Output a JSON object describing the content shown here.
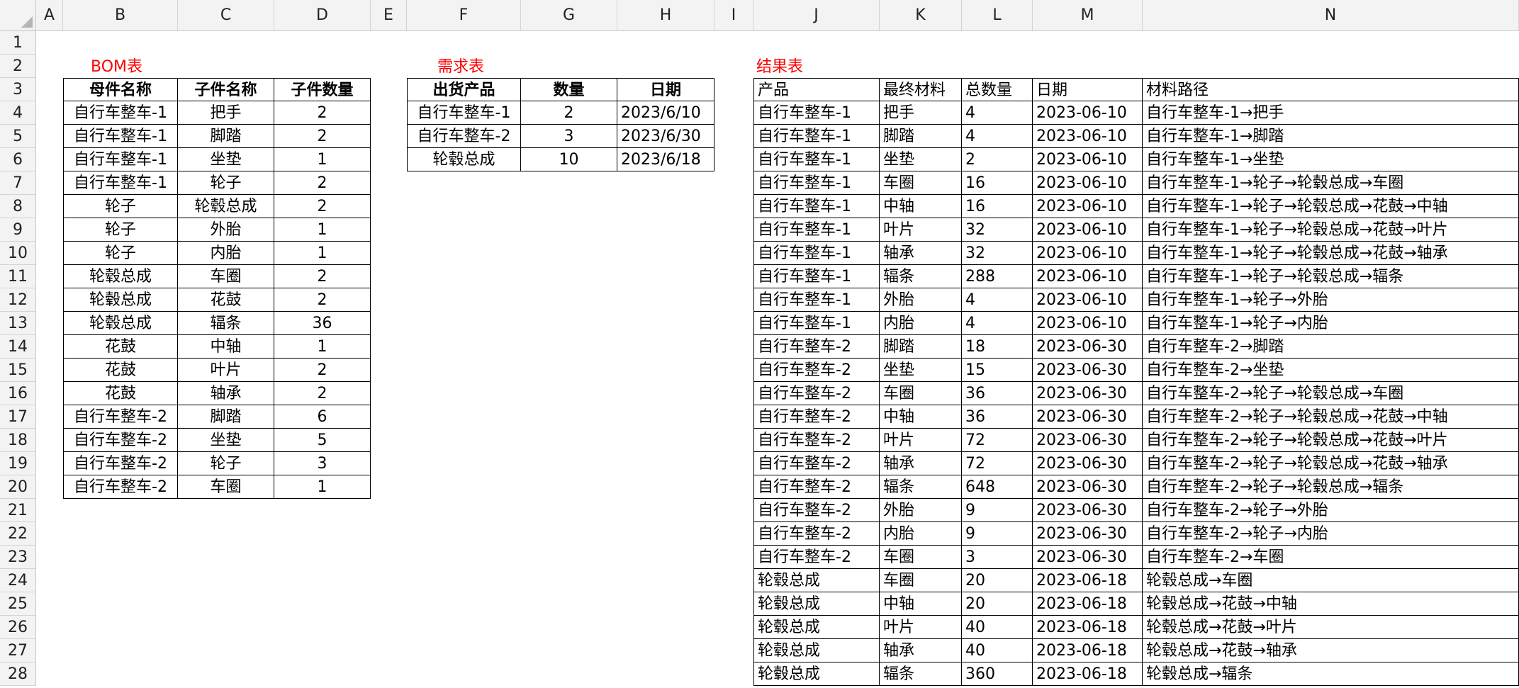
{
  "columns": [
    "A",
    "B",
    "C",
    "D",
    "E",
    "F",
    "G",
    "H",
    "I",
    "J",
    "K",
    "L",
    "M",
    "N"
  ],
  "rows": [
    "1",
    "2",
    "3",
    "4",
    "5",
    "6",
    "7",
    "8",
    "9",
    "10",
    "11",
    "12",
    "13",
    "14",
    "15",
    "16",
    "17",
    "18",
    "19",
    "20",
    "21",
    "22",
    "23",
    "24",
    "25",
    "26",
    "27",
    "28"
  ],
  "bom_table": {
    "title": "BOM表",
    "headers": [
      "母件名称",
      "子件名称",
      "子件数量"
    ],
    "rows": [
      [
        "自行车整车-1",
        "把手",
        "2"
      ],
      [
        "自行车整车-1",
        "脚踏",
        "2"
      ],
      [
        "自行车整车-1",
        "坐垫",
        "1"
      ],
      [
        "自行车整车-1",
        "轮子",
        "2"
      ],
      [
        "轮子",
        "轮毂总成",
        "2"
      ],
      [
        "轮子",
        "外胎",
        "1"
      ],
      [
        "轮子",
        "内胎",
        "1"
      ],
      [
        "轮毂总成",
        "车圈",
        "2"
      ],
      [
        "轮毂总成",
        "花鼓",
        "2"
      ],
      [
        "轮毂总成",
        "辐条",
        "36"
      ],
      [
        "花鼓",
        "中轴",
        "1"
      ],
      [
        "花鼓",
        "叶片",
        "2"
      ],
      [
        "花鼓",
        "轴承",
        "2"
      ],
      [
        "自行车整车-2",
        "脚踏",
        "6"
      ],
      [
        "自行车整车-2",
        "坐垫",
        "5"
      ],
      [
        "自行车整车-2",
        "轮子",
        "3"
      ],
      [
        "自行车整车-2",
        "车圈",
        "1"
      ]
    ]
  },
  "demand_table": {
    "title": "需求表",
    "headers": [
      "出货产品",
      "数量",
      "日期"
    ],
    "rows": [
      [
        "自行车整车-1",
        "2",
        "2023/6/10"
      ],
      [
        "自行车整车-2",
        "3",
        "2023/6/30"
      ],
      [
        "轮毂总成",
        "10",
        "2023/6/18"
      ]
    ]
  },
  "result_table": {
    "title": "结果表",
    "headers": [
      "产品",
      "最终材料",
      "总数量",
      "日期",
      "材料路径"
    ],
    "rows": [
      [
        "自行车整车-1",
        "把手",
        "4",
        "2023-06-10",
        "自行车整车-1→把手"
      ],
      [
        "自行车整车-1",
        "脚踏",
        "4",
        "2023-06-10",
        "自行车整车-1→脚踏"
      ],
      [
        "自行车整车-1",
        "坐垫",
        "2",
        "2023-06-10",
        "自行车整车-1→坐垫"
      ],
      [
        "自行车整车-1",
        "车圈",
        "16",
        "2023-06-10",
        "自行车整车-1→轮子→轮毂总成→车圈"
      ],
      [
        "自行车整车-1",
        "中轴",
        "16",
        "2023-06-10",
        "自行车整车-1→轮子→轮毂总成→花鼓→中轴"
      ],
      [
        "自行车整车-1",
        "叶片",
        "32",
        "2023-06-10",
        "自行车整车-1→轮子→轮毂总成→花鼓→叶片"
      ],
      [
        "自行车整车-1",
        "轴承",
        "32",
        "2023-06-10",
        "自行车整车-1→轮子→轮毂总成→花鼓→轴承"
      ],
      [
        "自行车整车-1",
        "辐条",
        "288",
        "2023-06-10",
        "自行车整车-1→轮子→轮毂总成→辐条"
      ],
      [
        "自行车整车-1",
        "外胎",
        "4",
        "2023-06-10",
        "自行车整车-1→轮子→外胎"
      ],
      [
        "自行车整车-1",
        "内胎",
        "4",
        "2023-06-10",
        "自行车整车-1→轮子→内胎"
      ],
      [
        "自行车整车-2",
        "脚踏",
        "18",
        "2023-06-30",
        "自行车整车-2→脚踏"
      ],
      [
        "自行车整车-2",
        "坐垫",
        "15",
        "2023-06-30",
        "自行车整车-2→坐垫"
      ],
      [
        "自行车整车-2",
        "车圈",
        "36",
        "2023-06-30",
        "自行车整车-2→轮子→轮毂总成→车圈"
      ],
      [
        "自行车整车-2",
        "中轴",
        "36",
        "2023-06-30",
        "自行车整车-2→轮子→轮毂总成→花鼓→中轴"
      ],
      [
        "自行车整车-2",
        "叶片",
        "72",
        "2023-06-30",
        "自行车整车-2→轮子→轮毂总成→花鼓→叶片"
      ],
      [
        "自行车整车-2",
        "轴承",
        "72",
        "2023-06-30",
        "自行车整车-2→轮子→轮毂总成→花鼓→轴承"
      ],
      [
        "自行车整车-2",
        "辐条",
        "648",
        "2023-06-30",
        "自行车整车-2→轮子→轮毂总成→辐条"
      ],
      [
        "自行车整车-2",
        "外胎",
        "9",
        "2023-06-30",
        "自行车整车-2→轮子→外胎"
      ],
      [
        "自行车整车-2",
        "内胎",
        "9",
        "2023-06-30",
        "自行车整车-2→轮子→内胎"
      ],
      [
        "自行车整车-2",
        "车圈",
        "3",
        "2023-06-30",
        "自行车整车-2→车圈"
      ],
      [
        "轮毂总成",
        "车圈",
        "20",
        "2023-06-18",
        "轮毂总成→车圈"
      ],
      [
        "轮毂总成",
        "中轴",
        "20",
        "2023-06-18",
        "轮毂总成→花鼓→中轴"
      ],
      [
        "轮毂总成",
        "叶片",
        "40",
        "2023-06-18",
        "轮毂总成→花鼓→叶片"
      ],
      [
        "轮毂总成",
        "轴承",
        "40",
        "2023-06-18",
        "轮毂总成→花鼓→轴承"
      ],
      [
        "轮毂总成",
        "辐条",
        "360",
        "2023-06-18",
        "轮毂总成→辐条"
      ]
    ]
  },
  "colors": {
    "title_red": "#ff0000",
    "header_bg": "#f3f3f3",
    "border": "#000000"
  }
}
